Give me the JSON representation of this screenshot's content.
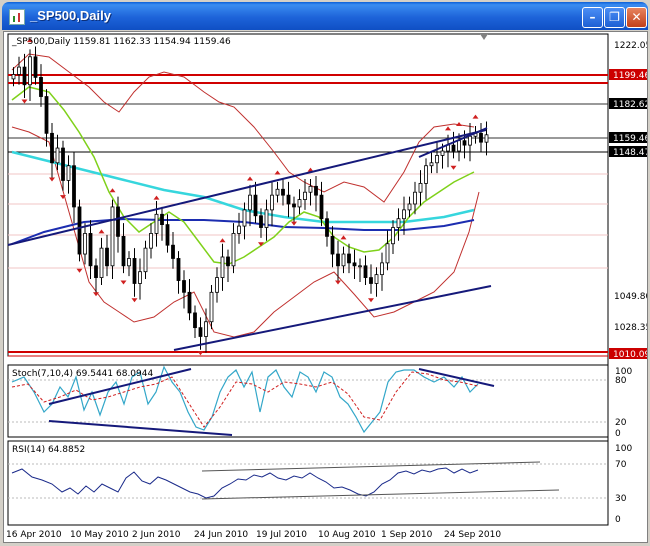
{
  "window": {
    "title": "_SP500,Daily"
  },
  "main_panel": {
    "header": "_SP500,Daily  1159.81 1162.33 1154.94 1159.46",
    "price_axis": [
      "1222.05",
      "1199.46",
      "1182.62",
      "1159.46",
      "1148.47",
      "1049.80",
      "1028.35",
      "1010.09"
    ]
  },
  "stoch_panel": {
    "header": "Stoch(7,10,4) 69.5441 68.0944",
    "axis": [
      "100",
      "80",
      "20",
      "0"
    ]
  },
  "rsi_panel": {
    "header": "RSI(14) 64.8852",
    "axis": [
      "100",
      "70",
      "30",
      "0"
    ]
  },
  "date_axis": [
    "16 Apr 2010",
    "10 May 2010",
    "2 Jun 2010",
    "24 Jun 2010",
    "19 Jul 2010",
    "10 Aug 2010",
    "1 Sep 2010",
    "24 Sep 2010"
  ],
  "colors": {
    "title_bar": "#1d63d9",
    "candles": "#000000",
    "bollinger": "#c0302e",
    "sma_fast": "#7fd11a",
    "sma_mid": "#36d6dd",
    "sma_slow": "#1c2db0",
    "trendline": "#15197a",
    "level_line": "#d00000",
    "stoch_main": "#33a7c9",
    "stoch_signal": "#d02020",
    "rsi_line": "#1a2a8a"
  },
  "chart_data": {
    "type": "candlestick",
    "symbol": "_SP500",
    "timeframe": "Daily",
    "last_bar": {
      "open": 1159.81,
      "high": 1162.33,
      "low": 1154.94,
      "close": 1159.46
    },
    "ylim": [
      1010.09,
      1222.05
    ],
    "series": [
      {
        "values": [
          1200,
          1205,
          1193,
          1212,
          1198,
          1185,
          1160,
          1140,
          1150,
          1128,
          1138,
          1110,
          1078,
          1092,
          1070,
          1062,
          1082,
          1070,
          1110,
          1090,
          1070,
          1075,
          1058,
          1066,
          1082,
          1092,
          1105,
          1098,
          1084,
          1075,
          1060,
          1052,
          1038,
          1028,
          1022,
          1032,
          1052,
          1062,
          1076,
          1070,
          1092,
          1097,
          1108,
          1118,
          1104,
          1096,
          1108,
          1118,
          1122,
          1118,
          1112,
          1110,
          1115,
          1120,
          1124,
          1118,
          1102,
          1090,
          1078,
          1070,
          1078,
          1072,
          1070,
          1070,
          1062,
          1058,
          1064,
          1072,
          1085,
          1096,
          1102,
          1108,
          1112,
          1120,
          1126,
          1138,
          1140,
          1145,
          1148,
          1152,
          1148,
          1155,
          1152,
          1158,
          1160,
          1154,
          1159
        ]
      },
      {
        "name": "Stoch(7,10,4)",
        "values": [
          69.5441,
          68.0944
        ]
      },
      {
        "name": "RSI(14)",
        "values": [
          64.8852
        ]
      }
    ],
    "levels": [
      1199.46,
      1182.62,
      1159.46,
      1148.47,
      1010.09
    ]
  }
}
